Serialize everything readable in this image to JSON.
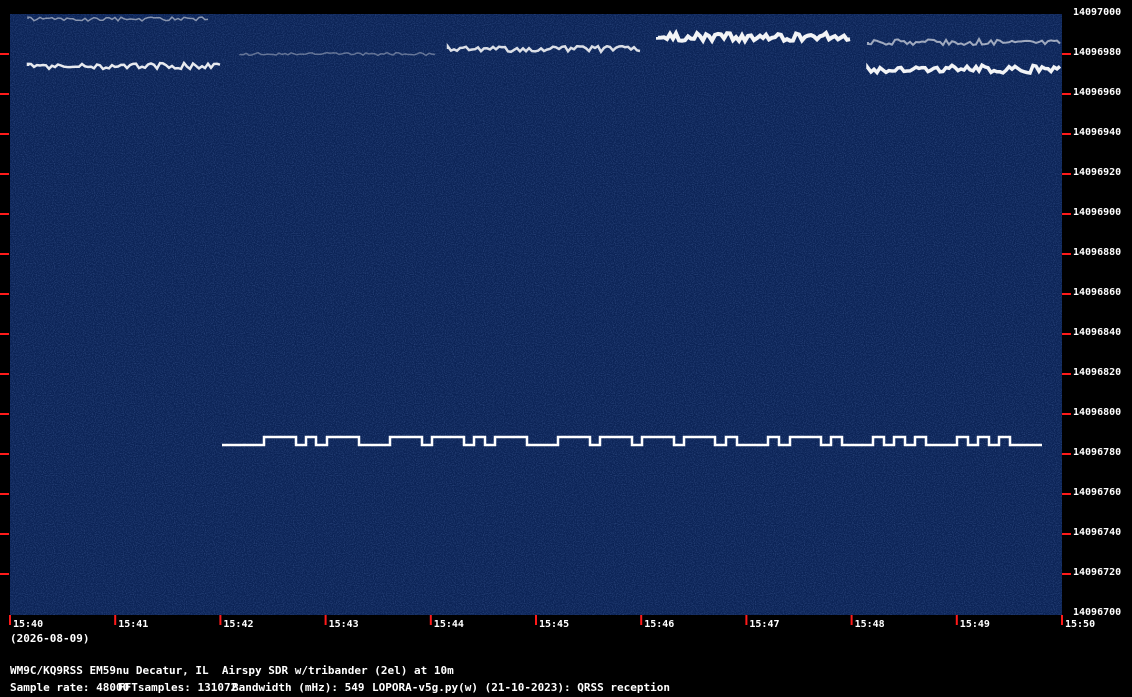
{
  "waterfall": {
    "background_color": "#0b2356",
    "tick_color": "#ff1a1a",
    "trace_color": "#ffffff"
  },
  "freq_axis": {
    "labels": [
      "14097000",
      "14096980",
      "14096960",
      "14096940",
      "14096920",
      "14096900",
      "14096880",
      "14096860",
      "14096840",
      "14096820",
      "14096800",
      "14096780",
      "14096760",
      "14096740",
      "14096720",
      "14096700"
    ]
  },
  "time_axis": {
    "labels": [
      "15:40",
      "15:41",
      "15:42",
      "15:43",
      "15:44",
      "15:45",
      "15:46",
      "15:47",
      "15:48",
      "15:49",
      "15:50"
    ],
    "date": "(2026-08-09)"
  },
  "footer": {
    "station": "WM9C/KQ9RSS EM59nu Decatur, IL  Airspy SDR w/tribander (2el) at 10m",
    "sample_rate": "Sample rate: 48000",
    "fft_samples": "FFTsamples: 131072",
    "bandwidth": "Bandwidth (mHz): 549",
    "software": "LOPORA-v5g.py(w) (21-10-2023): QRSS reception"
  }
}
